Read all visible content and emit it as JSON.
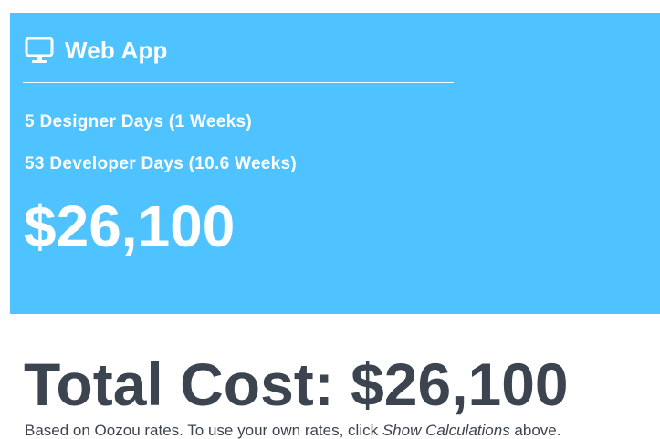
{
  "colors": {
    "card_background": "#4fc3ff",
    "card_text": "#ffffff",
    "body_text": "#3c4450"
  },
  "card": {
    "icon": "monitor-icon",
    "title": "Web App",
    "designer_days": "5 Designer Days (1 Weeks)",
    "developer_days": "53 Developer Days (10.6 Weeks)",
    "price": "$26,100"
  },
  "summary": {
    "total": "Total Cost: $26,100",
    "note_prefix": "Based on Oozou rates. To use your own rates, click ",
    "note_link": "Show Calculations",
    "note_suffix": " above."
  }
}
